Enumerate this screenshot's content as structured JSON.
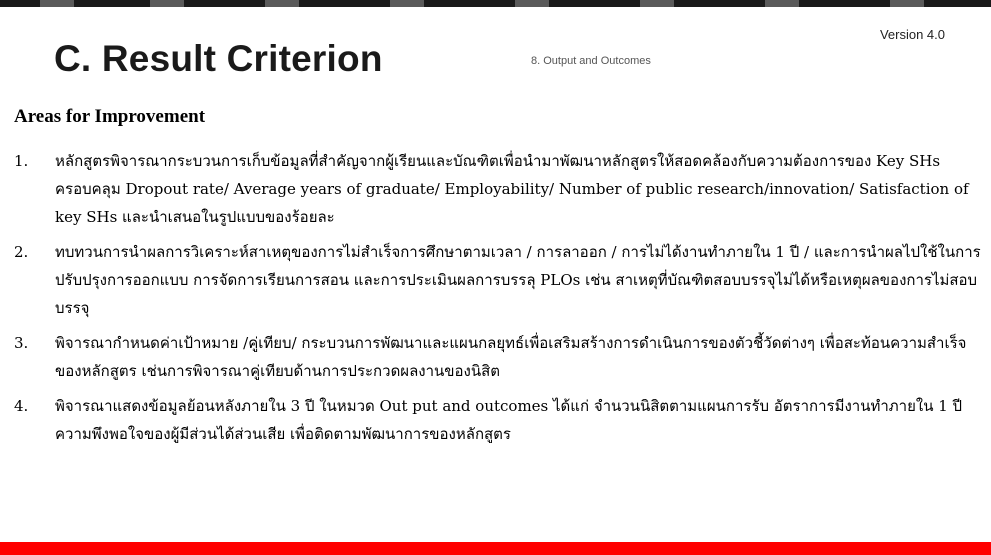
{
  "header": {
    "version": "Version 4.0",
    "title": "C.  Result Criterion",
    "subtitle": "8. Output and Outcomes"
  },
  "section": {
    "heading": "Areas for Improvement",
    "items": [
      {
        "number": "1.",
        "text": "หลักสูตรพิจารณากระบวนการเก็บข้อมูลที่สำคัญจากผู้เรียนและบัณฑิตเพื่อนำมาพัฒนาหลักสูตรให้สอดคล้องกับความต้องการของ Key SHs ครอบคลุม Dropout rate/ Average years of graduate/ Employability/ Number of public research/innovation/ Satisfaction of key SHs และนำเสนอในรูปแบบของร้อยละ"
      },
      {
        "number": "2.",
        "text": "ทบทวนการนำผลการวิเคราะห์สาเหตุของการไม่สำเร็จการศึกษาตามเวลา / การลาออก / การไม่ได้งานทำภายใน 1 ปี / และการนำผลไปใช้ในการปรับปรุงการออกแบบ การจัดการเรียนการสอน และการประเมินผลการบรรลุ PLOs เช่น สาเหตุที่บัณฑิตสอบบรรจุไม่ได้หรือเหตุผลของการไม่สอบบรรจุ"
      },
      {
        "number": "3.",
        "text": "พิจารณากำหนดค่าเป้าหมาย /คู่เทียบ/ กระบวนการพัฒนาและแผนกลยุทธ์เพื่อเสริมสร้างการดำเนินการของตัวชี้วัดต่างๆ เพื่อสะท้อนความสำเร็จของหลักสูตร เช่นการพิจารณาคู่เทียบด้านการประกวดผลงานของนิสิต"
      },
      {
        "number": "4.",
        "text": "พิจารณาแสดงข้อมูลย้อนหลังภายใน 3 ปี ในหมวด Out put and outcomes ได้แก่  จำนวนนิสิตตามแผนการรับ อัตราการมีงานทำภายใน 1 ปี ความพึงพอใจของผู้มีส่วนได้ส่วนเสีย  เพื่อติดตามพัฒนาการของหลักสูตร"
      }
    ]
  },
  "colors": {
    "bottom_bar": "#ff0000",
    "top_stripe": "#1a1a1a"
  }
}
